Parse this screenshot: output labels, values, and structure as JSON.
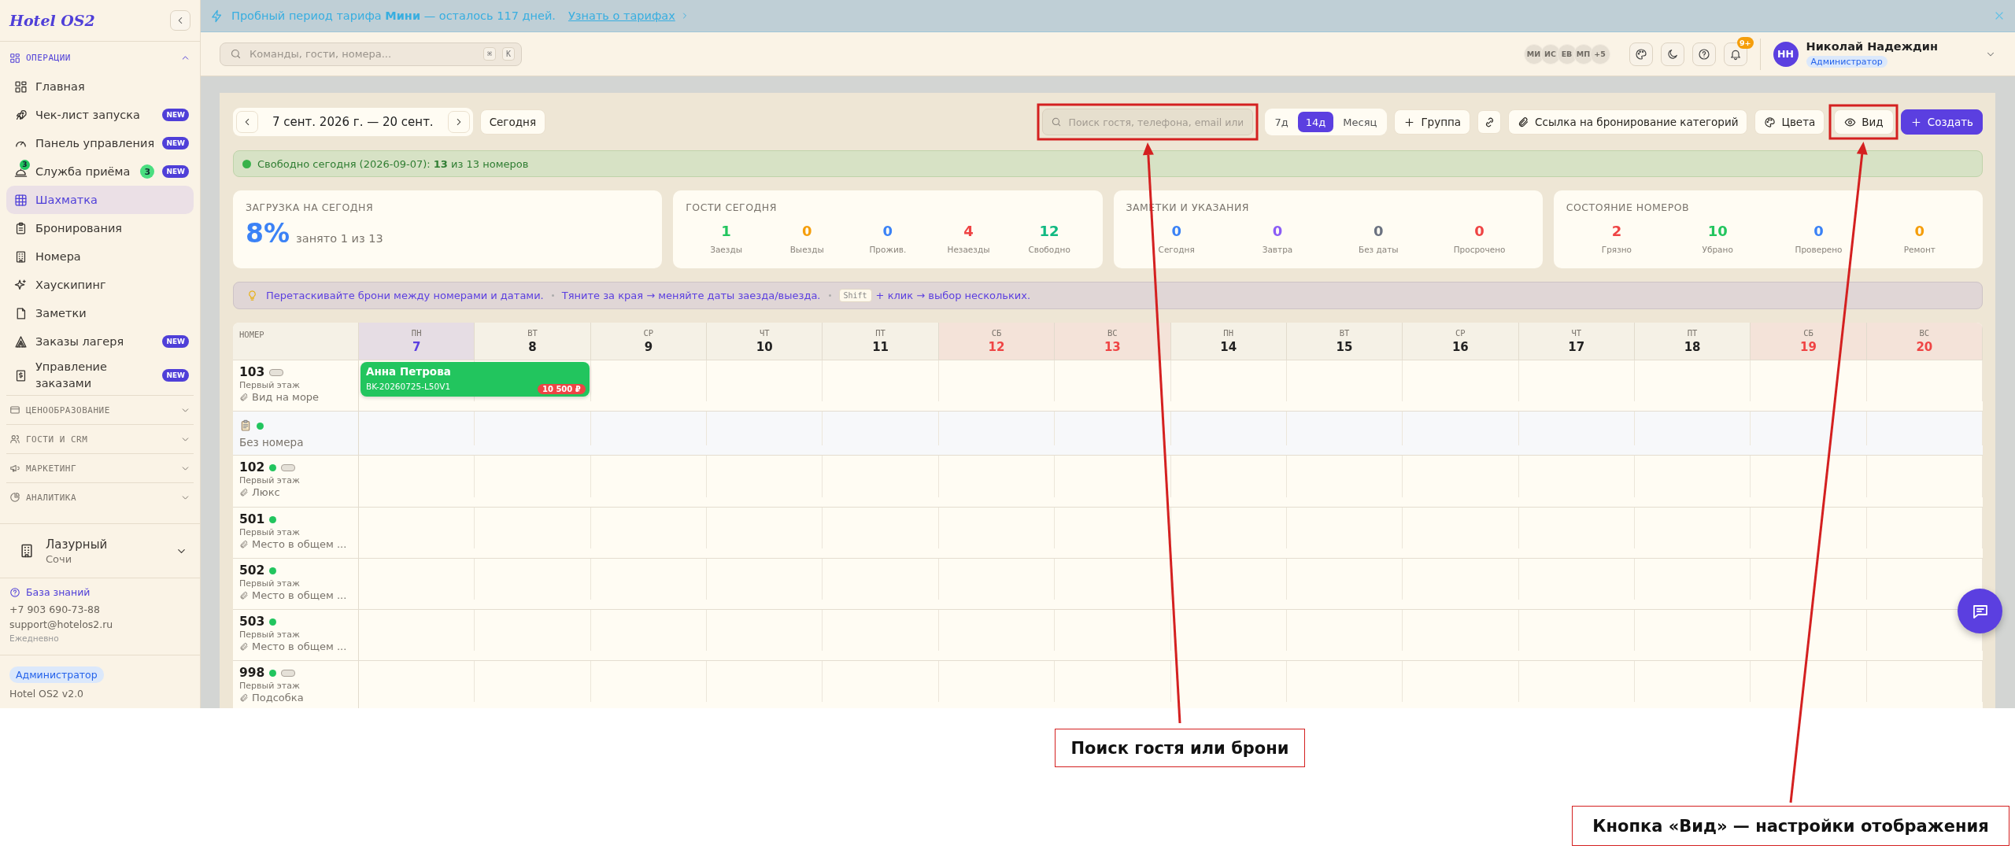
{
  "sidebar": {
    "logo": "Hotel OS2",
    "sections": [
      {
        "title": "ОПЕРАЦИИ",
        "expanded": true,
        "items": [
          {
            "label": "Главная",
            "selected": false
          },
          {
            "label": "Чек-лист запуска",
            "badge": "NEW",
            "selected": false
          },
          {
            "label": "Панель управления",
            "badge": "NEW",
            "selected": false
          },
          {
            "label": "Служба приёма",
            "icon_badge": "3",
            "count": "3",
            "badge": "NEW",
            "selected": false
          },
          {
            "label": "Шахматка",
            "selected": true
          },
          {
            "label": "Бронирования",
            "selected": false
          },
          {
            "label": "Номера",
            "selected": false
          },
          {
            "label": "Хаускипинг",
            "selected": false
          },
          {
            "label": "Заметки",
            "selected": false
          },
          {
            "label": "Заказы лагеря",
            "badge": "NEW",
            "selected": false
          },
          {
            "label": "Управление заказами",
            "badge": "NEW",
            "selected": false
          }
        ]
      },
      {
        "title": "ЦЕНООБРАЗОВАНИЕ",
        "expanded": false
      },
      {
        "title": "ГОСТИ И CRM",
        "expanded": false
      },
      {
        "title": "МАРКЕТИНГ",
        "expanded": false
      },
      {
        "title": "АНАЛИТИКА",
        "expanded": false
      }
    ],
    "property": {
      "name": "Лазурный",
      "city": "Сочи"
    },
    "help": {
      "link": "База знаний",
      "phone": "+7 903 690-73-88",
      "email": "support@hotelos2.ru",
      "hours": "Ежедневно"
    },
    "role": "Администратор",
    "version": "Hotel OS2 v2.0"
  },
  "banner": {
    "text": "Пробный период тарифа **Мини** — осталось 117 дней.",
    "link": "Узнать о тарифах"
  },
  "header": {
    "search_placeholder": "Команды, гости, номера...",
    "shortcut": [
      "⌘",
      "K"
    ],
    "presence": [
      "МИ",
      "ИС",
      "ЕВ",
      "МП",
      "+5"
    ],
    "notifications": "9+",
    "user": {
      "initials": "НН",
      "name": "Николай Надеждин",
      "role": "Администратор"
    }
  },
  "toolbar": {
    "range": "7 сент. 2026 г. — 20 сент.",
    "today": "Сегодня",
    "search_placeholder": "Поиск гостя, телефона, email или",
    "views": [
      {
        "label": "7д",
        "selected": false
      },
      {
        "label": "14д",
        "selected": true
      },
      {
        "label": "Месяц",
        "selected": false
      }
    ],
    "group": "Группа",
    "booking_link": "Ссылка на бронирование категорий",
    "colors": "Цвета",
    "view": "Вид",
    "create": "Создать"
  },
  "availability": "Свободно сегодня (2026-09-07): **13** из 13 номеров",
  "stats": [
    {
      "kind": "big",
      "title": "ЗАГРУЗКА НА СЕГОДНЯ",
      "value": "8%",
      "caption": "занято 1 из 13"
    },
    {
      "kind": "metrics",
      "title": "ГОСТИ СЕГОДНЯ",
      "metrics": [
        {
          "value": "1",
          "label": "Заезды",
          "color": "#22c55e"
        },
        {
          "value": "0",
          "label": "Выезды",
          "color": "#f59e0b"
        },
        {
          "value": "0",
          "label": "Прожив.",
          "color": "#3b82f6"
        },
        {
          "value": "4",
          "label": "Незаезды",
          "color": "#ef4444"
        },
        {
          "value": "12",
          "label": "Свободно",
          "color": "#10b981"
        }
      ]
    },
    {
      "kind": "metrics",
      "title": "ЗАМЕТКИ И УКАЗАНИЯ",
      "metrics": [
        {
          "value": "0",
          "label": "Сегодня",
          "color": "#3b82f6"
        },
        {
          "value": "0",
          "label": "Завтра",
          "color": "#8b5cf6"
        },
        {
          "value": "0",
          "label": "Без даты",
          "color": "#6b7280"
        },
        {
          "value": "0",
          "label": "Просрочено",
          "color": "#ef4444"
        }
      ]
    },
    {
      "kind": "metrics",
      "title": "СОСТОЯНИЕ НОМЕРОВ",
      "metrics": [
        {
          "value": "2",
          "label": "Грязно",
          "color": "#ef4444"
        },
        {
          "value": "10",
          "label": "Убрано",
          "color": "#22c55e"
        },
        {
          "value": "0",
          "label": "Проверено",
          "color": "#3b82f6"
        },
        {
          "value": "0",
          "label": "Ремонт",
          "color": "#f59e0b"
        }
      ]
    }
  ],
  "hint": {
    "tips": [
      "Перетаскивайте брони между номерами и датами.",
      "Тяните за края → меняйте даты заезда/выезда."
    ],
    "key": "Shift",
    "key_tip": "+ клик → выбор нескольких."
  },
  "board": {
    "room_header": "НОМЕР",
    "days": [
      {
        "dow": "ПН",
        "day": "7",
        "today": true,
        "weekend": false
      },
      {
        "dow": "ВТ",
        "day": "8",
        "today": false,
        "weekend": false
      },
      {
        "dow": "СР",
        "day": "9",
        "today": false,
        "weekend": false
      },
      {
        "dow": "ЧТ",
        "day": "10",
        "today": false,
        "weekend": false
      },
      {
        "dow": "ПТ",
        "day": "11",
        "today": false,
        "weekend": false
      },
      {
        "dow": "СБ",
        "day": "12",
        "today": false,
        "weekend": true
      },
      {
        "dow": "ВС",
        "day": "13",
        "today": false,
        "weekend": true
      },
      {
        "dow": "ПН",
        "day": "14",
        "today": false,
        "weekend": false
      },
      {
        "dow": "ВТ",
        "day": "15",
        "today": false,
        "weekend": false
      },
      {
        "dow": "СР",
        "day": "16",
        "today": false,
        "weekend": false
      },
      {
        "dow": "ЧТ",
        "day": "17",
        "today": false,
        "weekend": false
      },
      {
        "dow": "ПТ",
        "day": "18",
        "today": false,
        "weekend": false
      },
      {
        "dow": "СБ",
        "day": "19",
        "today": false,
        "weekend": true
      },
      {
        "dow": "ВС",
        "day": "20",
        "today": false,
        "weekend": true
      }
    ],
    "rows": [
      {
        "kind": "room",
        "number": "103",
        "available": false,
        "tagged": true,
        "floor": "Первый этаж",
        "type": "Вид на море",
        "bookings": [
          {
            "guest": "Анна Петрова",
            "code": "BK-20260725-L50V1",
            "price": "10 500 ₽"
          }
        ]
      },
      {
        "kind": "unassigned",
        "label": "Без номера",
        "available": true
      },
      {
        "kind": "room",
        "number": "102",
        "available": true,
        "tagged": true,
        "floor": "Первый этаж",
        "type": "Люкс"
      },
      {
        "kind": "room",
        "number": "501",
        "available": true,
        "tagged": false,
        "floor": "Первый этаж",
        "type": "Место в общем ..."
      },
      {
        "kind": "room",
        "number": "502",
        "available": true,
        "tagged": false,
        "floor": "Первый этаж",
        "type": "Место в общем ..."
      },
      {
        "kind": "room",
        "number": "503",
        "available": true,
        "tagged": false,
        "floor": "Первый этаж",
        "type": "Место в общем ..."
      },
      {
        "kind": "room",
        "number": "998",
        "available": true,
        "tagged": true,
        "floor": "Первый этаж",
        "type": "Подсобка"
      }
    ]
  },
  "annotations": [
    {
      "label": "Поиск гостя или брони"
    },
    {
      "label": "Кнопка «Вид» — настройки отображения"
    }
  ]
}
